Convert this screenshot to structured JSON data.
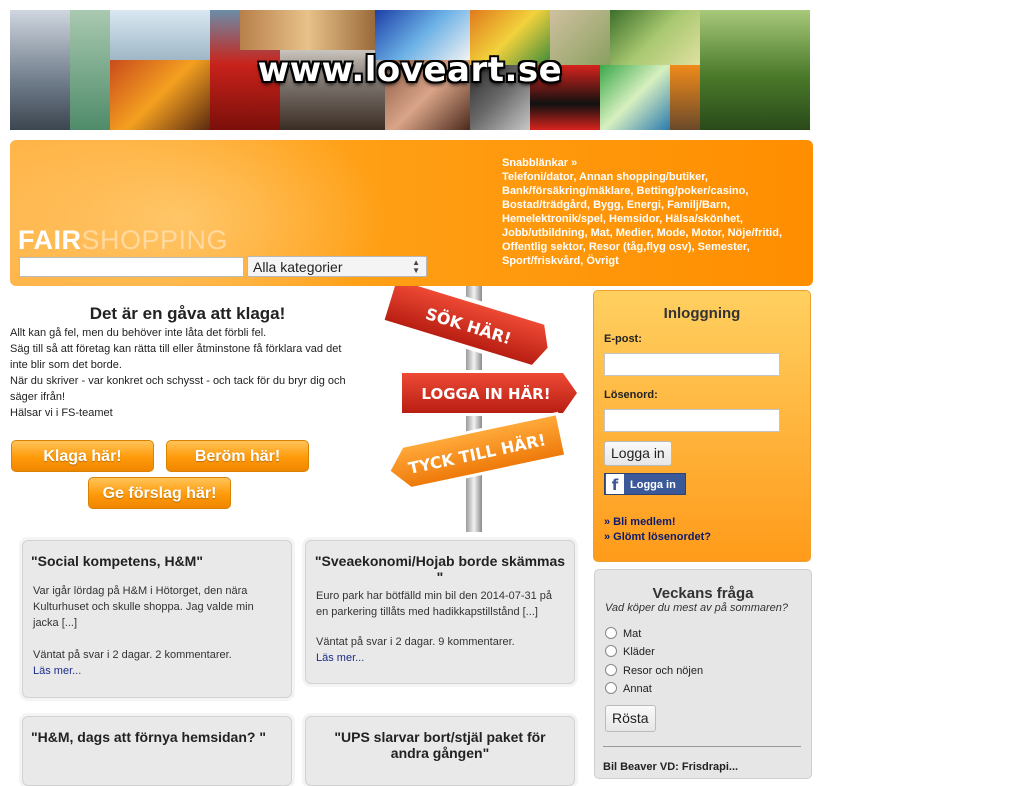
{
  "banner": {
    "url_text": "www.loveart.se"
  },
  "header": {
    "logo_fair": "FAIR",
    "logo_shopping": "SHOPPING",
    "search": {
      "value": "",
      "placeholder": ""
    },
    "category": "Alla kategorier",
    "quicklinks_title": "Snabblänkar »",
    "quicklinks": [
      "Telefoni/dator",
      "Annan shopping/butiker",
      "Bank/försäkring/mäklare",
      "Betting/poker/casino",
      "Bostad/trädgård",
      "Bygg",
      "Energi",
      "Familj/Barn",
      "Hemelektronik/spel",
      "Hemsidor",
      "Hälsa/skönhet",
      "Jobb/utbildning",
      "Mat",
      "Medier",
      "Mode",
      "Motor",
      "Nöje/fritid",
      "Offentlig sektor",
      "Resor (tåg,flyg osv)",
      "Semester",
      "Sport/friskvård",
      "Övrigt"
    ]
  },
  "intro": {
    "title": "Det är en gåva att klaga!",
    "lines": [
      "Allt kan gå fel, men du behöver inte låta det förbli fel.",
      "Säg till så att företag kan rätta till eller åtminstone få förklara vad det inte blir som det borde.",
      "När du skriver - var konkret och schysst - och tack för du bryr dig och säger ifrån!",
      "Hälsar vi i FS-teamet"
    ],
    "buttons": {
      "complain": "Klaga här!",
      "praise": "Beröm här!",
      "suggest": "Ge förslag här!"
    }
  },
  "signs": {
    "search": "SÖK HÄR!",
    "login": "LOGGA IN HÄR!",
    "opinion": "TYCK TILL HÄR!"
  },
  "login": {
    "title": "Inloggning",
    "email_label": "E-post:",
    "password_label": "Lösenord:",
    "login_button": "Logga in",
    "facebook_button": "Logga in",
    "member_link": "» Bli medlem!",
    "forgot_link": "» Glömt lösenordet?"
  },
  "poll": {
    "title": "Veckans fråga",
    "question": "Vad köper du mest av på sommaren?",
    "options": [
      "Mat",
      "Kläder",
      "Resor och nöjen",
      "Annat"
    ],
    "vote_button": "Rösta",
    "footer_text": "Bil Beaver VD: Frisdrapi..."
  },
  "cards": [
    {
      "title": "\"Social kompetens, H&M\"",
      "excerpt": "Var igår lördag på H&M i Hötorget, den nära Kulturhuset och skulle shoppa. Jag valde min jacka [...]",
      "status": "Väntat på svar i 2 dagar. 2 kommentarer.",
      "link": "Läs mer..."
    },
    {
      "title": "\"Sveaekonomi/Hojab borde skämmas \"",
      "excerpt": "Euro park har bötfälld min bil den 2014-07-31 på en parkering tillåts med hadikkapstillstånd [...]",
      "status": "Väntat på svar i 2 dagar. 9 kommentarer.",
      "link": "Läs mer..."
    },
    {
      "title": "\"H&M, dags att förnya hemsidan? \"",
      "excerpt": "",
      "status": "",
      "link": ""
    },
    {
      "title": "\"UPS slarvar bort/stjäl paket för andra gången\"",
      "excerpt": "",
      "status": "",
      "link": ""
    }
  ],
  "colors": {
    "brand_orange": "#ff9a0a",
    "link_blue": "#1a2c8a",
    "sign_red": "#d32a1e",
    "facebook_blue": "#3b5998"
  }
}
